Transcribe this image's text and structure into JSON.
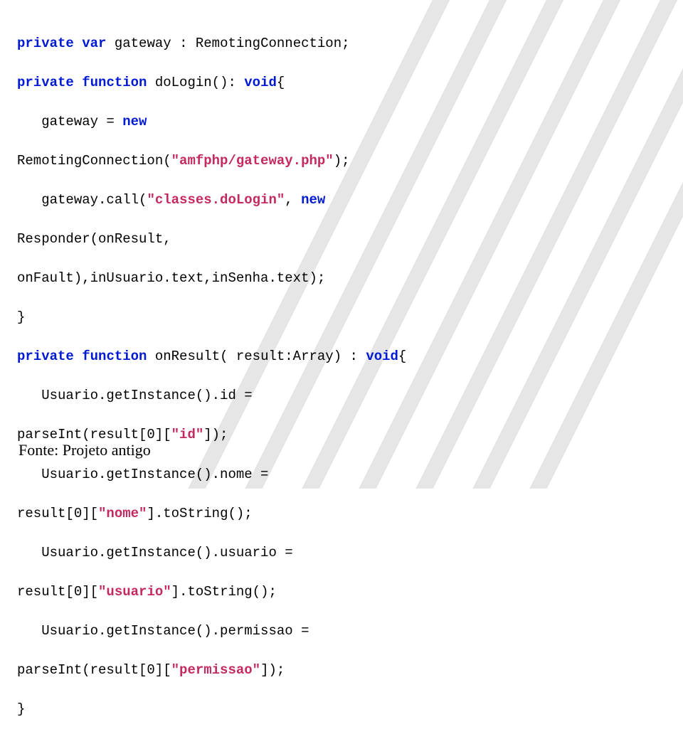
{
  "code": {
    "l1": {
      "t1": "private",
      "t2": " ",
      "t3": "var",
      "t4": " gateway : RemotingConnection;"
    },
    "l2": {
      "t1": "private",
      "t2": " ",
      "t3": "function",
      "t4": " doLogin(): ",
      "t5": "void",
      "t6": "{"
    },
    "l3": {
      "t1": "   gateway = ",
      "t2": "new"
    },
    "l4": {
      "t1": "RemotingConnection(",
      "t2": "\"amfphp/gateway.php\"",
      "t3": ");"
    },
    "l5": {
      "t1": "   gateway.call(",
      "t2": "\"classes.doLogin\"",
      "t3": ", ",
      "t4": "new"
    },
    "l6": {
      "t1": "Responder(onResult,"
    },
    "l7": {
      "t1": "onFault),inUsuario.text,inSenha.text);"
    },
    "l8": {
      "t1": "}"
    },
    "l9": {
      "t1": "private",
      "t2": " ",
      "t3": "function",
      "t4": " onResult( result:Array) : ",
      "t5": "void",
      "t6": "{"
    },
    "l10": {
      "t1": "   Usuario.getInstance().id ="
    },
    "l11": {
      "t1": "parseInt(result[0][",
      "t2": "\"id\"",
      "t3": "]);"
    },
    "l12": {
      "t1": "   Usuario.getInstance().nome ="
    },
    "l13": {
      "t1": "result[0][",
      "t2": "\"nome\"",
      "t3": "].toString();"
    },
    "l14": {
      "t1": "   Usuario.getInstance().usuario ="
    },
    "l15": {
      "t1": "result[0][",
      "t2": "\"usuario\"",
      "t3": "].toString();"
    },
    "l16": {
      "t1": "   Usuario.getInstance().permissao ="
    },
    "l17": {
      "t1": "parseInt(result[0][",
      "t2": "\"permissao\"",
      "t3": "]);"
    },
    "l18": {
      "t1": "}"
    }
  },
  "footer": "Fonte: Projeto antigo"
}
